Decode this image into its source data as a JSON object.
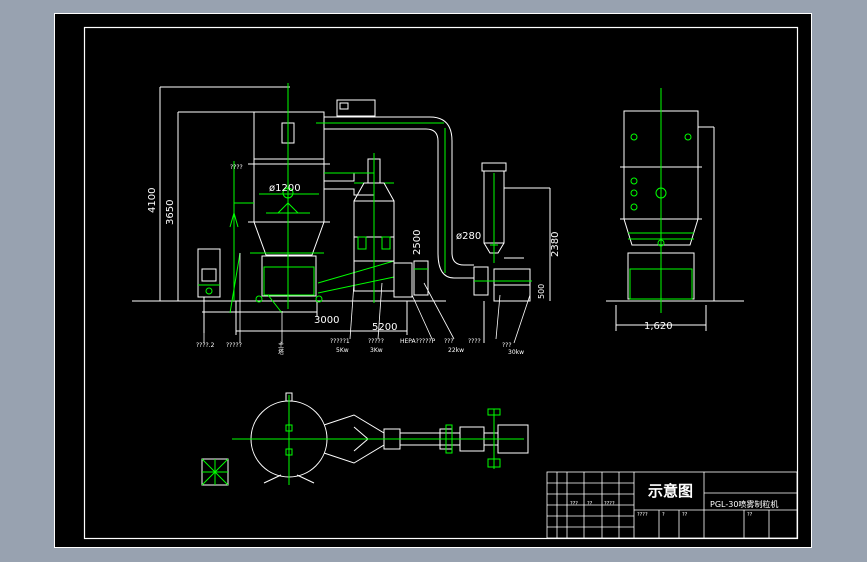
{
  "colors": {
    "background": "#98a2b0",
    "sheet": "#000000",
    "line": "#ffffff",
    "equipment": "#00ff00",
    "dimension": "#ffffff"
  },
  "dimensions": {
    "total_height": "4100",
    "upper_height": "3650",
    "tower_diameter": "ø1200",
    "left_width": "3000",
    "total_width": "5200",
    "cyclone_height": "2500",
    "duct_diameter": "ø280",
    "filter_height": "2380",
    "fan_height": "500",
    "side_width": "1,620",
    "small_top": "????"
  },
  "callouts": [
    {
      "label": "????.2",
      "sub": ""
    },
    {
      "label": "?????",
      "sub": ""
    },
    {
      "label": "主",
      "sub": "塔"
    },
    {
      "label": "?????1",
      "sub": "5Kw"
    },
    {
      "label": "?????",
      "sub": "3Kw"
    },
    {
      "label": "HEPA?????P",
      "sub": ""
    },
    {
      "label": "???",
      "sub": "22kw"
    },
    {
      "label": "????",
      "sub": ""
    },
    {
      "label": "???",
      "sub": "30kw"
    }
  ],
  "title_block": {
    "drawing_title": "示意图",
    "drawing_name": "PGL-30喷雾制粒机",
    "cells_row1": [
      "???",
      "??",
      "????"
    ],
    "cells_row2": [
      "????",
      "?",
      "??",
      "??"
    ]
  }
}
